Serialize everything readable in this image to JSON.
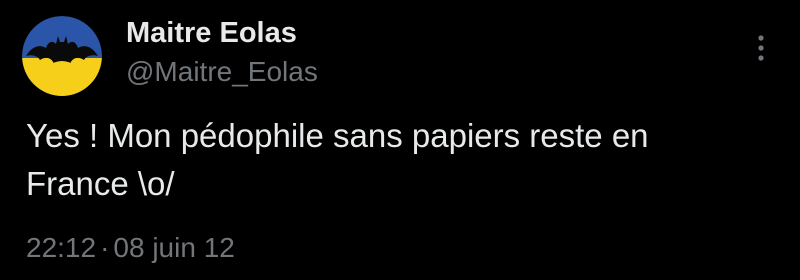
{
  "author": {
    "display_name": "Maitre Eolas",
    "handle": "@Maitre_Eolas",
    "avatar_icon": "bat-logo-avatar-icon",
    "avatar_colors": {
      "top": "#2a55a8",
      "bottom": "#f6cf1a",
      "bat": "#0a0a0a"
    }
  },
  "tweet": {
    "text_line1": "Yes ! Mon pédophile sans papiers reste en",
    "text_line2": "France \\o/",
    "time": "22:12",
    "separator": "·",
    "date": "08 juin 12"
  },
  "more_menu_icon": "more-vertical-icon",
  "colors": {
    "background": "#000000",
    "primary_text": "#e7e9ea",
    "secondary_text": "#71767b"
  }
}
